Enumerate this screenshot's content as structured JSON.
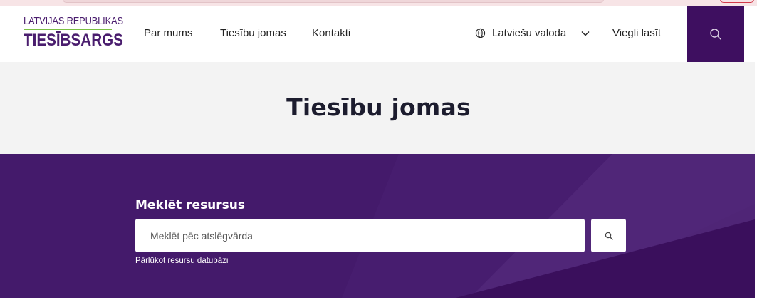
{
  "header": {
    "logo": {
      "top_line": "LATVIJAS REPUBLIKAS",
      "main_line": "TIESĪBSARGS"
    },
    "nav": [
      {
        "label": "Par mums"
      },
      {
        "label": "Tiesību jomas",
        "active": true
      },
      {
        "label": "Kontakti"
      }
    ],
    "language": {
      "icon": "globe-icon",
      "label": "Latviešu valoda",
      "dropdown_icon": "chevron-down-icon"
    },
    "easy_read_label": "Viegli lasīt",
    "search_icon": "search-icon"
  },
  "hero": {
    "title": "Tiesību jomas"
  },
  "search": {
    "heading": "Meklēt resursus",
    "placeholder": "Meklēt pēc atslēgvārda",
    "value": "",
    "button_icon": "search-icon",
    "browse_link": "Pārlūkot resursu datubāzi"
  },
  "colors": {
    "brand_purple": "#4a1d6e",
    "dark_purple": "#3e0f60",
    "section_purple": "#441a6b",
    "accent_green": "#7bc043",
    "hero_gray": "#f3f3f3"
  }
}
